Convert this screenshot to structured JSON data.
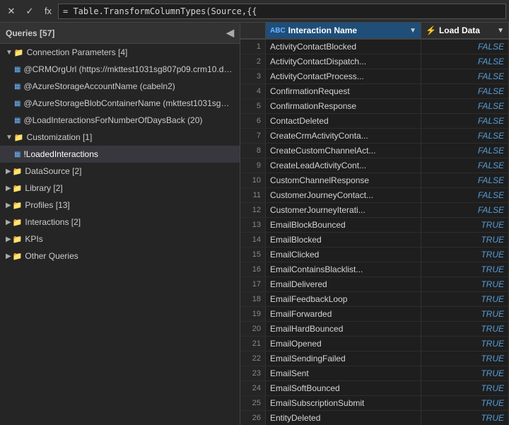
{
  "formula_bar": {
    "cancel_label": "✕",
    "confirm_label": "✓",
    "fx_label": "fx",
    "formula_value": "= Table.TransformColumnTypes(Source,{{"
  },
  "queries_panel": {
    "title": "Queries [57]",
    "collapse_icon": "◀",
    "groups": [
      {
        "id": "connection-parameters",
        "label": "Connection Parameters [4]",
        "expanded": true,
        "indent": 0,
        "type": "folder",
        "children": [
          {
            "label": "@CRMOrgUrl (https://mkttest1031sg807p09.crm10.dy...",
            "indent": 1,
            "type": "query"
          },
          {
            "label": "@AzureStorageAccountName (cabeln2)",
            "indent": 1,
            "type": "query"
          },
          {
            "label": "@AzureStorageBlobContainerName (mkttest1031sg80...",
            "indent": 1,
            "type": "query"
          },
          {
            "label": "@LoadInteractionsForNumberOfDaysBack (20)",
            "indent": 1,
            "type": "query"
          }
        ]
      },
      {
        "id": "customization",
        "label": "Customization [1]",
        "expanded": true,
        "indent": 0,
        "type": "folder",
        "children": [
          {
            "label": "!LoadedInteractions",
            "indent": 1,
            "type": "query",
            "selected": true
          }
        ]
      },
      {
        "id": "datasource",
        "label": "DataSource [2]",
        "expanded": false,
        "indent": 0,
        "type": "folder"
      },
      {
        "id": "library",
        "label": "Library [2]",
        "expanded": false,
        "indent": 0,
        "type": "folder"
      },
      {
        "id": "profiles",
        "label": "Profiles [13]",
        "expanded": false,
        "indent": 0,
        "type": "folder"
      },
      {
        "id": "interactions",
        "label": "Interactions [2]",
        "expanded": false,
        "indent": 0,
        "type": "folder"
      },
      {
        "id": "kpis",
        "label": "KPIs",
        "expanded": false,
        "indent": 0,
        "type": "folder"
      },
      {
        "id": "other-queries",
        "label": "Other Queries",
        "expanded": false,
        "indent": 0,
        "type": "folder"
      }
    ]
  },
  "grid": {
    "columns": [
      {
        "label": "Interaction Name",
        "type": "ABC",
        "color": "blue"
      },
      {
        "label": "Load Data",
        "type": "lightning",
        "color": "green"
      }
    ],
    "rows": [
      {
        "num": 1,
        "name": "ActivityContactBlocked",
        "load": "FALSE"
      },
      {
        "num": 2,
        "name": "ActivityContactDispatch...",
        "load": "FALSE"
      },
      {
        "num": 3,
        "name": "ActivityContactProcess...",
        "load": "FALSE"
      },
      {
        "num": 4,
        "name": "ConfirmationRequest",
        "load": "FALSE"
      },
      {
        "num": 5,
        "name": "ConfirmationResponse",
        "load": "FALSE"
      },
      {
        "num": 6,
        "name": "ContactDeleted",
        "load": "FALSE"
      },
      {
        "num": 7,
        "name": "CreateCrmActivityConta...",
        "load": "FALSE"
      },
      {
        "num": 8,
        "name": "CreateCustomChannelAct...",
        "load": "FALSE"
      },
      {
        "num": 9,
        "name": "CreateLeadActivityCont...",
        "load": "FALSE"
      },
      {
        "num": 10,
        "name": "CustomChannelResponse",
        "load": "FALSE"
      },
      {
        "num": 11,
        "name": "CustomerJourneyContact...",
        "load": "FALSE"
      },
      {
        "num": 12,
        "name": "CustomerJourneyIterati...",
        "load": "FALSE"
      },
      {
        "num": 13,
        "name": "EmailBlockBounced",
        "load": "TRUE"
      },
      {
        "num": 14,
        "name": "EmailBlocked",
        "load": "TRUE"
      },
      {
        "num": 15,
        "name": "EmailClicked",
        "load": "TRUE"
      },
      {
        "num": 16,
        "name": "EmailContainsBlacklist...",
        "load": "TRUE"
      },
      {
        "num": 17,
        "name": "EmailDelivered",
        "load": "TRUE"
      },
      {
        "num": 18,
        "name": "EmailFeedbackLoop",
        "load": "TRUE"
      },
      {
        "num": 19,
        "name": "EmailForwarded",
        "load": "TRUE"
      },
      {
        "num": 20,
        "name": "EmailHardBounced",
        "load": "TRUE"
      },
      {
        "num": 21,
        "name": "EmailOpened",
        "load": "TRUE"
      },
      {
        "num": 22,
        "name": "EmailSendingFailed",
        "load": "TRUE"
      },
      {
        "num": 23,
        "name": "EmailSent",
        "load": "TRUE"
      },
      {
        "num": 24,
        "name": "EmailSoftBounced",
        "load": "TRUE"
      },
      {
        "num": 25,
        "name": "EmailSubscriptionSubmit",
        "load": "TRUE"
      },
      {
        "num": 26,
        "name": "EntityDeleted",
        "load": "TRUE"
      }
    ]
  }
}
